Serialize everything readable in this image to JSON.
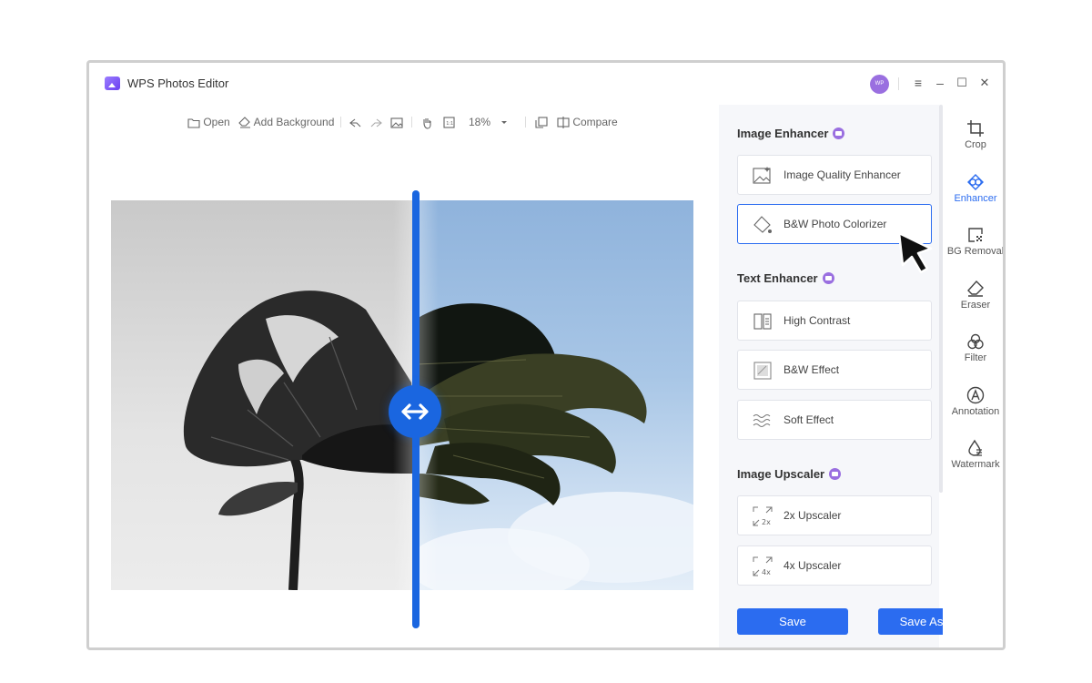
{
  "window": {
    "title": "WPS Photos Editor",
    "avatar_text": "WP",
    "controls": {
      "menu": "≡",
      "minimize": "–",
      "maximize": "☐",
      "close": "✕"
    }
  },
  "toolbar": {
    "open_label": "Open",
    "add_background_label": "Add Background",
    "zoom_value": "18%",
    "compare_label": "Compare"
  },
  "panel": {
    "image_enhancer": {
      "title": "Image Enhancer",
      "options": [
        {
          "label": "Image Quality Enhancer",
          "icon": "image-quality-icon"
        },
        {
          "label": "B&W Photo Colorizer",
          "icon": "colorizer-bucket-icon",
          "active": true
        }
      ]
    },
    "text_enhancer": {
      "title": "Text Enhancer",
      "options": [
        {
          "label": "High Contrast",
          "icon": "high-contrast-icon"
        },
        {
          "label": "B&W Effect",
          "icon": "bw-effect-icon"
        },
        {
          "label": "Soft Effect",
          "icon": "soft-effect-icon"
        }
      ]
    },
    "image_upscaler": {
      "title": "Image Upscaler",
      "options": [
        {
          "label": "2x Upscaler",
          "icon": "upscale-2x-icon",
          "icon_text": "2x"
        },
        {
          "label": "4x Upscaler",
          "icon": "upscale-4x-icon",
          "icon_text": "4x"
        }
      ]
    },
    "save_label": "Save",
    "save_as_label": "Save As"
  },
  "rail": {
    "items": [
      {
        "label": "Crop",
        "icon": "crop-icon"
      },
      {
        "label": "Enhancer",
        "icon": "enhancer-icon",
        "active": true
      },
      {
        "label": "BG Removal",
        "icon": "bg-removal-icon"
      },
      {
        "label": "Eraser",
        "icon": "eraser-icon"
      },
      {
        "label": "Filter",
        "icon": "filter-icon"
      },
      {
        "label": "Annotation",
        "icon": "annotation-icon"
      },
      {
        "label": "Watermark",
        "icon": "watermark-icon"
      }
    ]
  },
  "colors": {
    "accent": "#2b6cf0",
    "handle": "#1a66e0",
    "badge": "#9a6fe0"
  }
}
